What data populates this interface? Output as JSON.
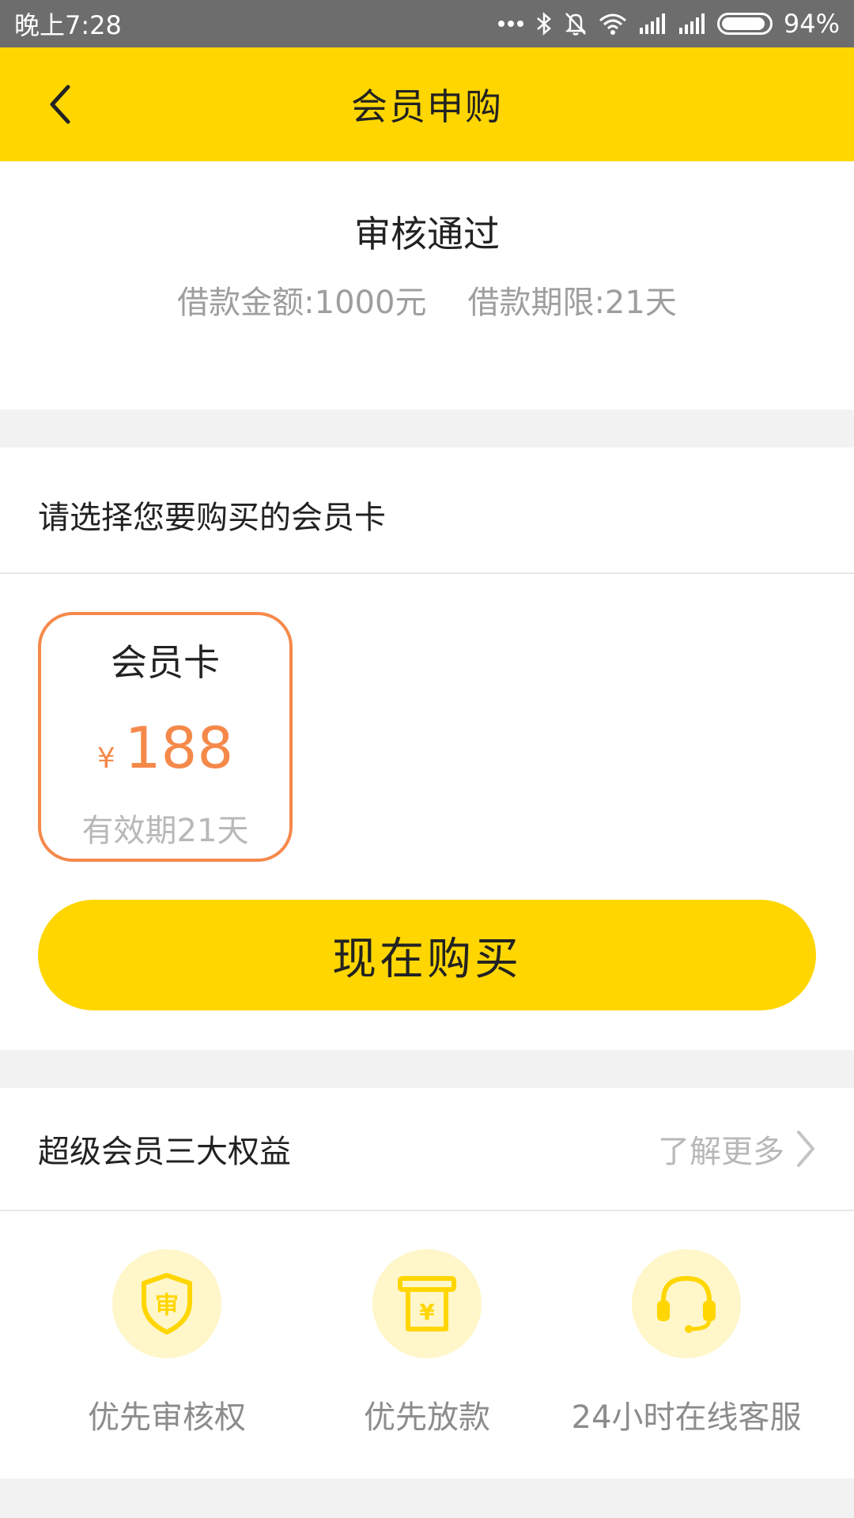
{
  "status_bar": {
    "time": "晚上7:28",
    "battery": "94%",
    "battery_level": 0.94,
    "icons": [
      "more-dots-icon",
      "bluetooth-icon",
      "mute-bell-icon",
      "wifi-icon",
      "signal-icon",
      "signal-icon",
      "battery-icon"
    ]
  },
  "nav": {
    "title": "会员申购",
    "back_icon": "back-chevron-icon"
  },
  "approval": {
    "title": "审核通过",
    "amount": "借款金额:1000元",
    "term": "借款期限:21天"
  },
  "membership": {
    "heading": "请选择您要购买的会员卡",
    "card": {
      "name": "会员卡",
      "currency": "¥",
      "price": "188",
      "validity": "有效期21天"
    },
    "buy_label": "现在购买"
  },
  "benefits": {
    "title": "超级会员三大权益",
    "learn_more": "了解更多",
    "items": [
      {
        "icon": "shield-review-icon",
        "label": "优先审核权"
      },
      {
        "icon": "cash-dispense-icon",
        "label": "优先放款"
      },
      {
        "icon": "headset-icon",
        "label": "24小时在线客服"
      }
    ]
  },
  "colors": {
    "brand_yellow": "#ffd600",
    "accent_orange": "#f5894a",
    "status_bar": "#6d6d6d",
    "icon_circle": "#fff6c9"
  }
}
